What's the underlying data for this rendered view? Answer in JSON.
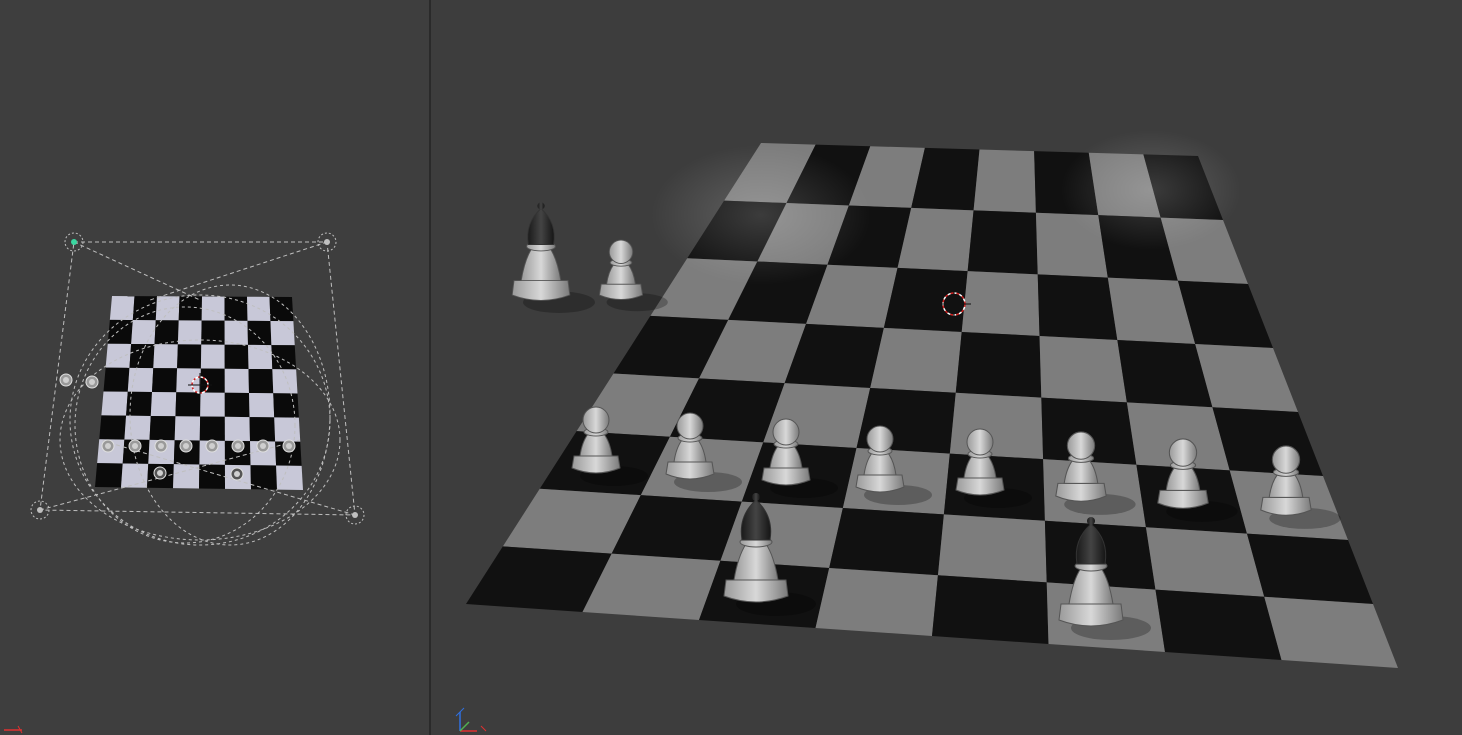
{
  "app": {
    "name": "",
    "editor": "3D Viewport"
  },
  "viewports": [
    {
      "id": "left",
      "view": "top",
      "contents": [
        "checkerboard",
        "camera-gizmos",
        "light-gizmos",
        "3d-cursor",
        "pawns"
      ],
      "board": {
        "rows": 8,
        "cols": 8
      }
    },
    {
      "id": "right",
      "view": "perspective",
      "contents": [
        "checkerboard",
        "3d-cursor",
        "pawns",
        "bishops"
      ],
      "board": {
        "rows": 8,
        "cols": 8
      }
    }
  ],
  "colors": {
    "background": "#3d3d3d",
    "board_light_left": "#c8c8d8",
    "board_dark_left": "#0a0a0a",
    "board_light_right": "#7d7d7d",
    "board_dark_right": "#111111",
    "cursor": "#d02020",
    "gizmo": "#bfbfbf",
    "active_light": "#3ad6a0",
    "axis_x": "#e03030",
    "axis_y": "#50b050",
    "axis_z": "#3070e0"
  }
}
